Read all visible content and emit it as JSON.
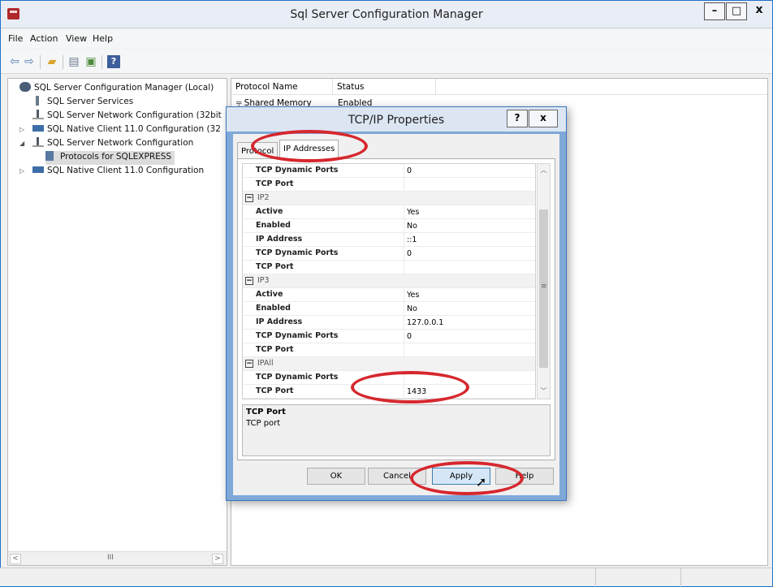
{
  "window": {
    "title": "Sql Server Configuration Manager",
    "min_glyph": "–",
    "max_glyph": "□",
    "close_glyph": "x"
  },
  "menu": [
    "File",
    "Action",
    "View",
    "Help"
  ],
  "toolbar": {
    "icons": [
      "back-arrow-icon",
      "forward-arrow-icon",
      "up-folder-icon",
      "show-hide-tree-icon",
      "export-list-icon",
      "help-icon"
    ]
  },
  "tree": {
    "items": [
      {
        "label": "SQL Server Configuration Manager (Local)",
        "icon": "server-icon"
      },
      {
        "label": "SQL Server Services",
        "icon": "service-icon"
      },
      {
        "label": "SQL Server Network Configuration (32bit",
        "icon": "network-icon"
      },
      {
        "label": "SQL Native Client 11.0 Configuration (32",
        "icon": "client-icon"
      },
      {
        "label": "SQL Server Network Configuration",
        "icon": "network-icon"
      },
      {
        "label": "Protocols for SQLEXPRESS",
        "icon": "protocols-icon"
      },
      {
        "label": "SQL Native Client 11.0 Configuration",
        "icon": "client-icon"
      }
    ],
    "hscroll_mark": "III"
  },
  "list": {
    "columns": [
      "Protocol Name",
      "Status"
    ],
    "rows": [
      {
        "name": "Shared Memory",
        "status": "Enabled"
      }
    ]
  },
  "dialog": {
    "title": "TCP/IP Properties",
    "help_glyph": "?",
    "close_glyph": "x",
    "tabs": [
      "Protocol",
      "IP Addresses"
    ],
    "grid": [
      {
        "type": "prop",
        "name": "TCP Dynamic Ports",
        "value": "0"
      },
      {
        "type": "prop",
        "name": "TCP Port",
        "value": ""
      },
      {
        "type": "cat",
        "name": "IP2"
      },
      {
        "type": "prop",
        "name": "Active",
        "value": "Yes"
      },
      {
        "type": "prop",
        "name": "Enabled",
        "value": "No"
      },
      {
        "type": "prop",
        "name": "IP Address",
        "value": "::1"
      },
      {
        "type": "prop",
        "name": "TCP Dynamic Ports",
        "value": "0"
      },
      {
        "type": "prop",
        "name": "TCP Port",
        "value": ""
      },
      {
        "type": "cat",
        "name": "IP3"
      },
      {
        "type": "prop",
        "name": "Active",
        "value": "Yes"
      },
      {
        "type": "prop",
        "name": "Enabled",
        "value": "No"
      },
      {
        "type": "prop",
        "name": "IP Address",
        "value": "127.0.0.1"
      },
      {
        "type": "prop",
        "name": "TCP Dynamic Ports",
        "value": "0"
      },
      {
        "type": "prop",
        "name": "TCP Port",
        "value": ""
      },
      {
        "type": "cat",
        "name": "IPAll"
      },
      {
        "type": "prop",
        "name": "TCP Dynamic Ports",
        "value": ""
      },
      {
        "type": "prop",
        "name": "TCP Port",
        "value": "1433"
      }
    ],
    "description": {
      "title": "TCP Port",
      "text": "TCP port"
    },
    "buttons": {
      "ok": "OK",
      "cancel": "Cancel",
      "apply": "Apply",
      "help": "Help"
    }
  },
  "colors": {
    "annotation": "#d6272e",
    "dialog_frame": "#7fa8d8",
    "window_border": "#1f73c8"
  }
}
